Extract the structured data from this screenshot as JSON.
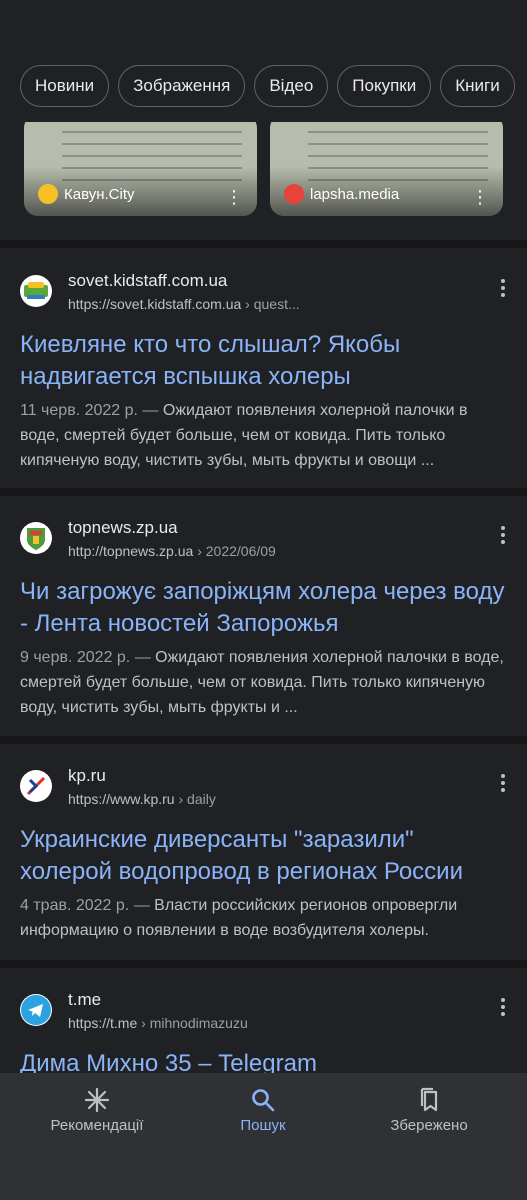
{
  "chips": [
    "Новини",
    "Зображення",
    "Відео",
    "Покупки",
    "Книги"
  ],
  "images": [
    {
      "source": "Кавун.City",
      "dot_color": "#f6c026"
    },
    {
      "source": "lapsha.media",
      "dot_color": "#e8433a"
    }
  ],
  "results": [
    {
      "site": "sovet.kidstaff.com.ua",
      "url": "https://sovet.kidstaff.com.ua",
      "url_path": " › quest...",
      "title": "Киевляне кто что слышал? Якобы надвигается вспышка холеры",
      "date": "11 черв. 2022 р. — ",
      "snippet": "Ожидают появления холерной палочки в воде, смертей будет больше, чем от ковида. Пить только кипяченую воду, чистить зубы, мыть фрукты и овощи ...",
      "icon": "kidstaff-favicon"
    },
    {
      "site": "topnews.zp.ua",
      "url": "http://topnews.zp.ua",
      "url_path": " › 2022/06/09",
      "title": "Чи загрожує запоріжцям холера через воду - Лента новостей Запорожья",
      "date": "9 черв. 2022 р. — ",
      "snippet": "Ожидают появления холерной палочки в воде, смертей будет больше, чем от ковида. Пить только кипяченую воду, чистить зубы, мыть фрукты и ...",
      "icon": "topnews-favicon"
    },
    {
      "site": "kp.ru",
      "url": "https://www.kp.ru",
      "url_path": " › daily",
      "title": "Украинские диверсанты \"заразили\" холерой водопровод в регионах России",
      "date": "4 трав. 2022 р. — ",
      "snippet": "Власти российских регионов опровергли информацию о появлении в воде возбудителя холеры.",
      "icon": "kp-favicon"
    },
    {
      "site": "t.me",
      "url": "https://t.me",
      "url_path": " › mihnodimazuzu",
      "title": "Дима Михно 35 – Telegram",
      "date": "",
      "snippet": "",
      "icon": "telegram-favicon"
    }
  ],
  "nav": {
    "items": [
      {
        "label": "Рекомендації",
        "icon": "asterisk-icon"
      },
      {
        "label": "Пошук",
        "icon": "search-icon",
        "active": true
      },
      {
        "label": "Збережено",
        "icon": "bookmarks-icon"
      }
    ]
  },
  "colors": {
    "background": "#202124",
    "link": "#8ab4f8",
    "text": "#bdc1c6"
  }
}
